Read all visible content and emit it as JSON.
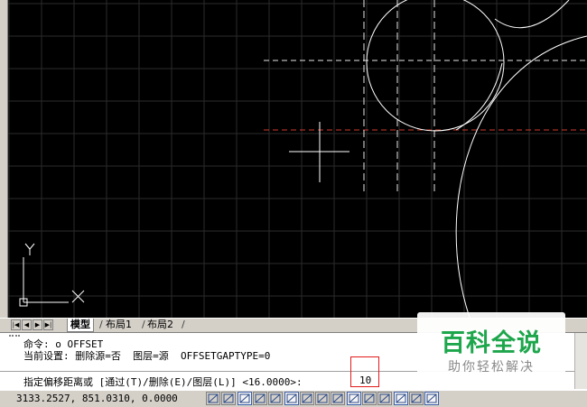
{
  "window": {
    "accent_colors": {
      "background": "#000000",
      "grid": "#2b2b2b",
      "geometry": "#ffffff",
      "dashed_axis_white": "#e6e6e6",
      "dashed_axis_red": "#d23c2c",
      "highlight_box": "#e11a1a"
    }
  },
  "drawing": {
    "ucs_axis_labels": {
      "x": "X",
      "y": "Y"
    }
  },
  "layout_tabs": {
    "nav_icons": [
      "first-tab-icon",
      "prev-tab-icon",
      "next-tab-icon",
      "last-tab-icon"
    ],
    "tabs": [
      {
        "label": "模型",
        "active": true
      },
      {
        "label": "布局1",
        "active": false
      },
      {
        "label": "布局2",
        "active": false
      }
    ]
  },
  "command": {
    "history": [
      "命令: o OFFSET",
      "当前设置: 删除源=否  图层=源  OFFSETGAPTYPE=0"
    ],
    "prompt": "指定偏移距离或 [通过(T)/删除(E)/图层(L)] <16.0000>:",
    "input_value": "10"
  },
  "watermark": {
    "title": "百科全说",
    "subtitle": "助你轻松解决"
  },
  "status_bar": {
    "coordinates": "3133.2527, 851.0310, 0.0000",
    "toggles": [
      {
        "icon": "infer-constraints-icon",
        "on": false
      },
      {
        "icon": "snap-icon",
        "on": false
      },
      {
        "icon": "grid-display-icon",
        "on": true
      },
      {
        "icon": "ortho-icon",
        "on": false
      },
      {
        "icon": "polar-tracking-icon",
        "on": false
      },
      {
        "icon": "object-snap-icon",
        "on": true
      },
      {
        "icon": "3d-object-snap-icon",
        "on": false
      },
      {
        "icon": "object-snap-tracking-icon",
        "on": false
      },
      {
        "icon": "dynamic-ucs-icon",
        "on": false
      },
      {
        "icon": "dynamic-input-icon",
        "on": true
      },
      {
        "icon": "lineweight-icon",
        "on": false
      },
      {
        "icon": "transparency-icon",
        "on": false
      },
      {
        "icon": "quick-properties-icon",
        "on": true
      },
      {
        "icon": "selection-cycling-icon",
        "on": false
      },
      {
        "icon": "annotation-monitor-icon",
        "on": true
      }
    ]
  }
}
